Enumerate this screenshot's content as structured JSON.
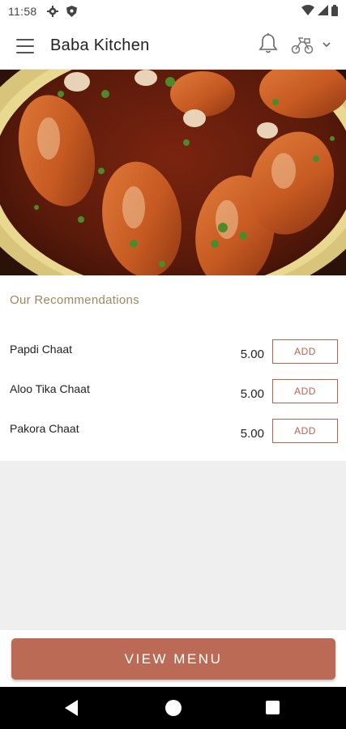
{
  "status_bar": {
    "time": "11:58",
    "icons": [
      "settings-icon",
      "shield-icon",
      "wifi-icon",
      "signal-icon",
      "battery-icon"
    ]
  },
  "app_bar": {
    "title": "Baba Kitchen",
    "icons": [
      "menu-icon",
      "bell-icon",
      "scooter-icon",
      "chevron-down-icon"
    ]
  },
  "hero": {
    "description_icon": "hero-food-image"
  },
  "recommendations": {
    "title": "Our Recommendations",
    "items": [
      {
        "name": "Papdi Chaat",
        "price": "5.00",
        "button": "ADD"
      },
      {
        "name": "Aloo Tika Chaat",
        "price": "5.00",
        "button": "ADD"
      },
      {
        "name": "Pakora Chaat",
        "price": "5.00",
        "button": "ADD"
      }
    ]
  },
  "footer": {
    "view_menu_label": "VIEW MENU"
  },
  "colors": {
    "accent": "#bb6a56",
    "section_title": "#a08660",
    "background": "#efefef"
  }
}
